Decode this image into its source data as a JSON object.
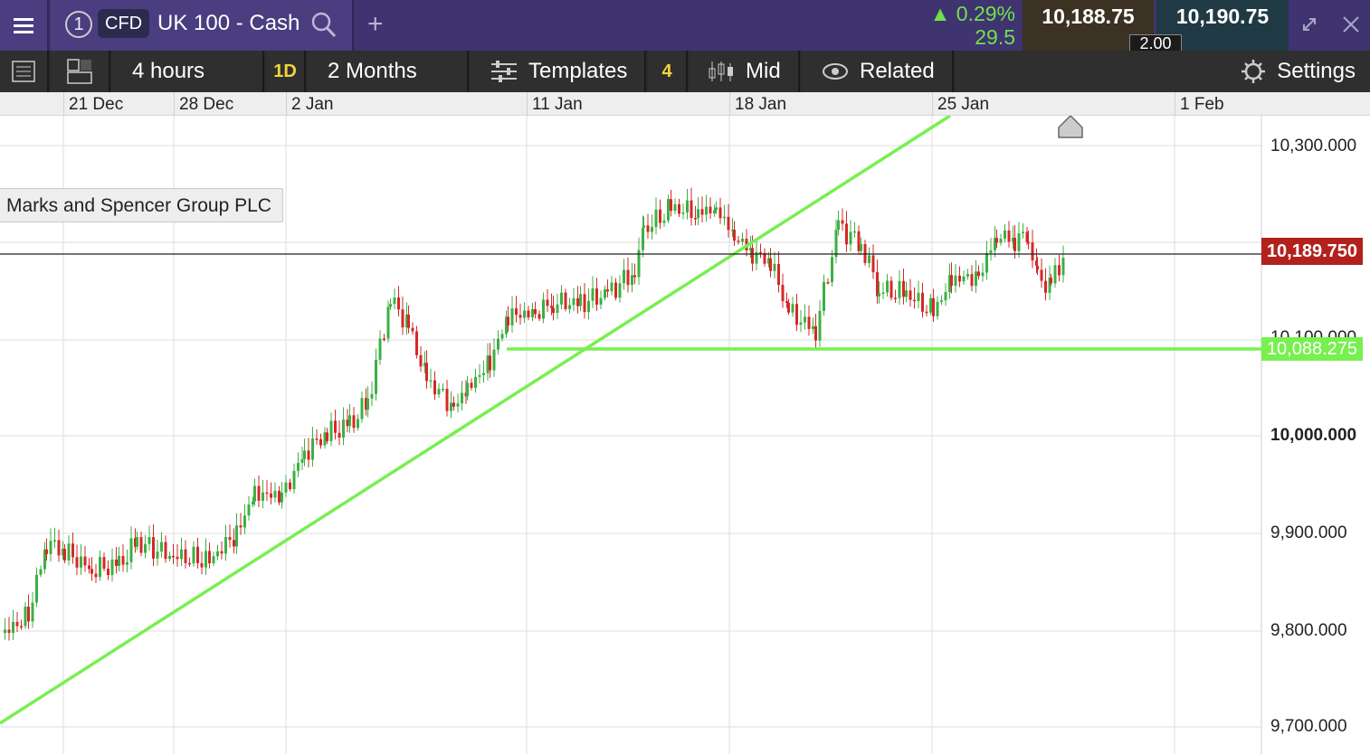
{
  "header": {
    "tab_number": "1",
    "instrument_type": "CFD",
    "instrument_name": "UK 100 - Cash",
    "change_percent": "0.29%",
    "change_points": "29.5",
    "sell_price": "10,188.75",
    "buy_price": "10,190.75",
    "spread": "2.00"
  },
  "toolbar": {
    "interval": "4 hours",
    "interval_badge": "1D",
    "range": "2 Months",
    "templates_label": "Templates",
    "templates_count": "4",
    "price_mode": "Mid",
    "related_label": "Related",
    "settings_label": "Settings"
  },
  "chart": {
    "dates": [
      "21 Dec",
      "28 Dec",
      "2 Jan",
      "11 Jan",
      "18 Jan",
      "25 Jan",
      "1 Feb"
    ],
    "annotation": "Marks and Spencer Group PLC",
    "current_price_tag": "10,189.750",
    "horizontal_line_tag": "10,088.275",
    "price_labels": [
      {
        "text": "10,300.000",
        "bold": false
      },
      {
        "text": "10,100.000",
        "bold": false
      },
      {
        "text": "10,000.000",
        "bold": true
      },
      {
        "text": "9,900.000",
        "bold": false
      },
      {
        "text": "9,800.000",
        "bold": false
      },
      {
        "text": "9,700.000",
        "bold": false
      }
    ],
    "colors": {
      "up": "#3cb043",
      "down": "#d62728",
      "trendline": "#77f050",
      "current": "#b2211c"
    }
  }
}
